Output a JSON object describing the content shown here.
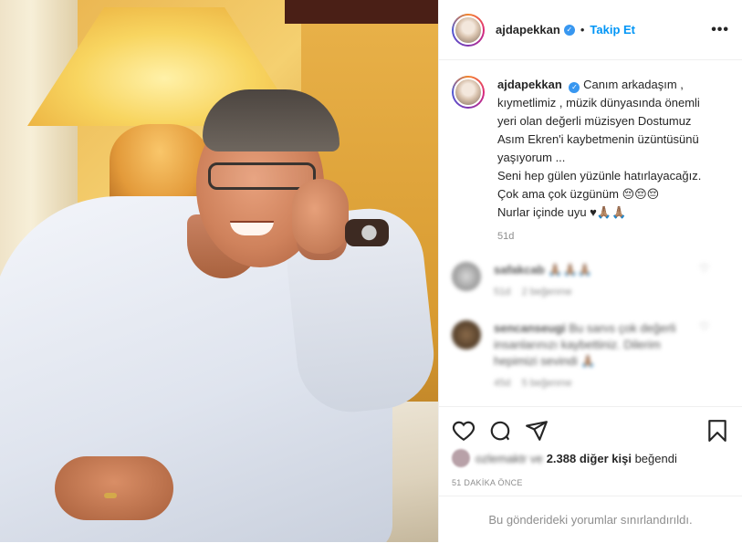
{
  "header": {
    "username": "ajdapekkan",
    "separator": "•",
    "follow_label": "Takip Et",
    "more_label": "•••"
  },
  "caption": {
    "username": "ajdapekkan",
    "text_lines": [
      "Canım arkadaşım ,",
      "kıymetlimiz , müzik dünyasında önemli",
      "yeri olan değerli müzisyen Dostumuz",
      "Asım Ekren'i kaybetmenin üzüntüsünü",
      "yaşıyorum ...",
      "Seni hep gülen yüzünle hatırlayacağız.",
      "Çok ama çok üzgünüm 😔😔😔",
      "Nurlar içinde uyu ♥🙏🏽🙏🏽"
    ],
    "time": "51d"
  },
  "comments": [
    {
      "username": "safakcab",
      "text": "🙏🏽🙏🏽🙏🏽",
      "time": "51d",
      "replies_label": "2 beğenme"
    },
    {
      "username": "sencanseugi",
      "text": "Bu sanıs çok değerli insanlarınızı kaybettiniz. Dilerim hepimizi sevindi 🙏🏽",
      "time": "45d",
      "replies_label": "5 beğenme"
    }
  ],
  "actions": {
    "like_icon": "heart-icon",
    "comment_icon": "comment-icon",
    "share_icon": "share-icon",
    "save_icon": "bookmark-icon"
  },
  "likes": {
    "blurred_name": "ozlemaktr ve",
    "count_text": "2.388 diğer kişi",
    "suffix": "beğendi"
  },
  "posted_ago": "51 DAKİKA ÖNCE",
  "comments_limited": "Bu gönderideki yorumlar sınırlandırıldı.",
  "colors": {
    "accent": "#0095f6",
    "verified": "#3897f0",
    "muted": "#8e8e8e",
    "border": "#efefef"
  }
}
